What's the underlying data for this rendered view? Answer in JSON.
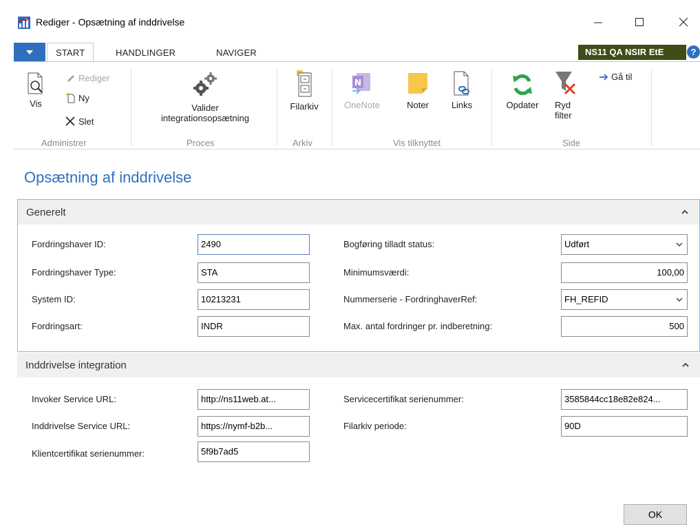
{
  "window": {
    "title": "Rediger - Opsætning af inddrivelse"
  },
  "ribbon": {
    "tabs": [
      {
        "label": "START"
      },
      {
        "label": "HANDLINGER"
      },
      {
        "label": "NAVIGER"
      }
    ],
    "environment_badge": "NS11 QA NSIR EtE",
    "help_icon": "?",
    "groups": {
      "administrer": {
        "label": "Administrer",
        "vis": "Vis",
        "rediger": "Rediger",
        "ny": "Ny",
        "slet": "Slet"
      },
      "proces": {
        "label": "Proces",
        "valider_line1": "Valider",
        "valider_line2": "integrationsopsætning"
      },
      "arkiv": {
        "label": "Arkiv",
        "filarkiv": "Filarkiv"
      },
      "vis_tilknyttet": {
        "label": "Vis tilknyttet",
        "onenote": "OneNote",
        "noter": "Noter",
        "links": "Links"
      },
      "side": {
        "label": "Side",
        "opdater": "Opdater",
        "ryd_line1": "Ryd",
        "ryd_line2": "filter",
        "gaa_til": "Gå til"
      }
    }
  },
  "page": {
    "title": "Opsætning af inddrivelse"
  },
  "generelt": {
    "title": "Generelt",
    "fields": {
      "fordringshaver_id": {
        "label": "Fordringshaver ID:",
        "value": "2490"
      },
      "fordringshaver_type": {
        "label": "Fordringshaver Type:",
        "value": "STA"
      },
      "system_id": {
        "label": "System ID:",
        "value": "10213231"
      },
      "fordringsart": {
        "label": "Fordringsart:",
        "value": "INDR"
      },
      "bogforing_status": {
        "label": "Bogføring tilladt status:",
        "value": "Udført"
      },
      "minimumsvaerdi": {
        "label": "Minimumsværdi:",
        "value": "100,00"
      },
      "nummerserie": {
        "label": "Nummerserie - FordringhaverRef:",
        "value": "FH_REFID"
      },
      "max_antal": {
        "label": "Max. antal fordringer pr. indberetning:",
        "value": "500"
      }
    }
  },
  "integration": {
    "title": "Inddrivelse integration",
    "fields": {
      "invoker_url": {
        "label": "Invoker Service URL:",
        "value": "http://ns11web.at..."
      },
      "inddrivelse_url": {
        "label": "Inddrivelse Service URL:",
        "value": "https://nymf-b2b..."
      },
      "klientcert": {
        "label": "Klientcertifikat serienummer:",
        "value": "5f9b7ad5"
      },
      "servicecert": {
        "label": "Servicecertifikat serienummer:",
        "value": "3585844cc18e82e824..."
      },
      "filarkiv_periode": {
        "label": "Filarkiv periode:",
        "value": "90D"
      }
    }
  },
  "footer": {
    "ok_label": "OK"
  },
  "colors": {
    "accent": "#2f6fbd",
    "badge_bg": "#3f4d16",
    "fasttab_bg": "#f0f0f0",
    "disabled_text": "#a8a8a8"
  }
}
